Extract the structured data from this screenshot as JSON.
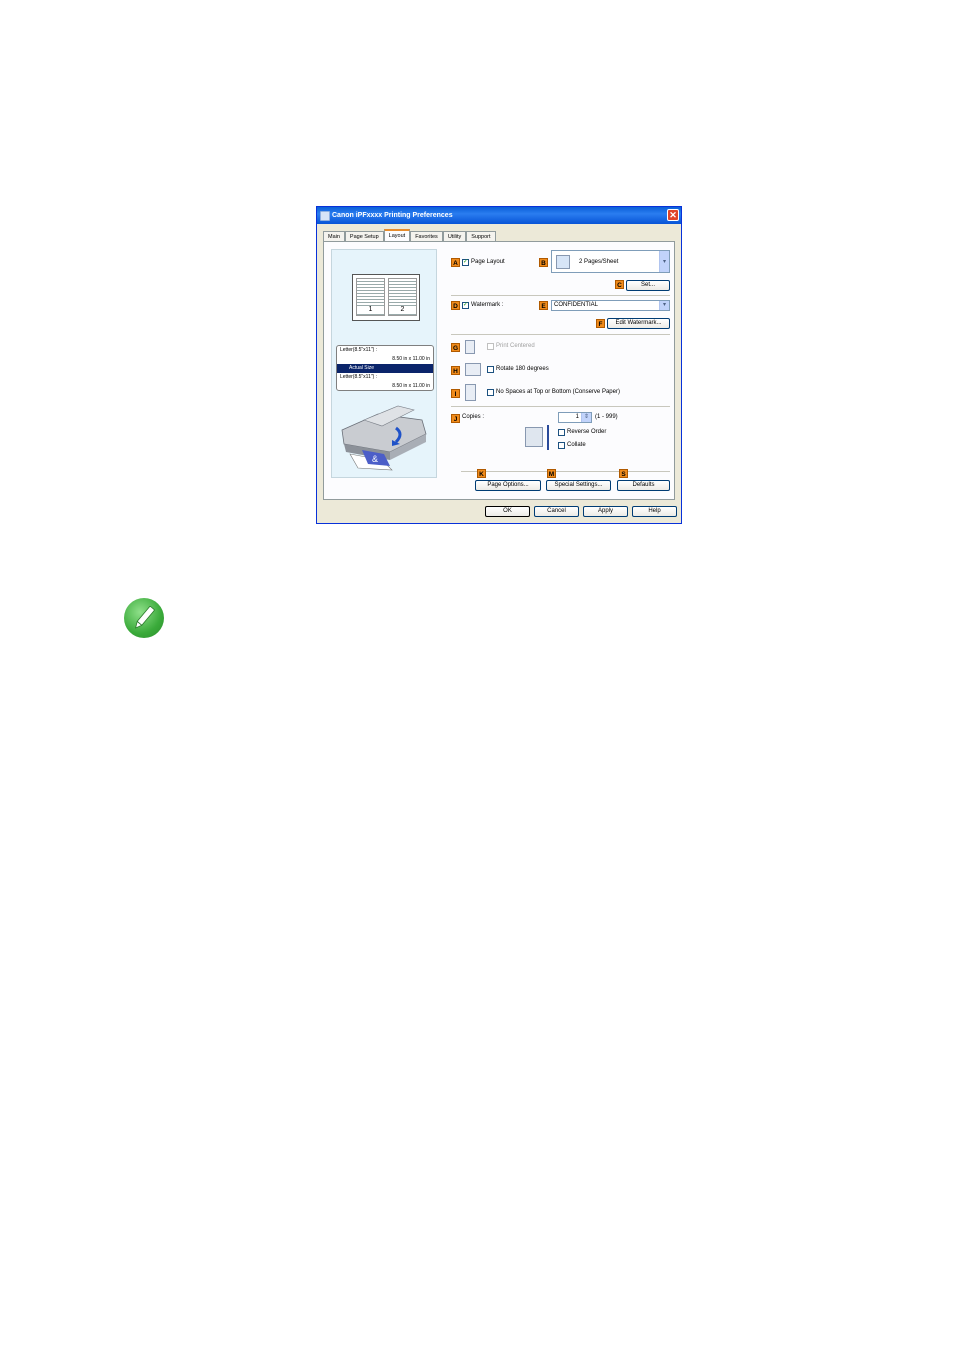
{
  "window": {
    "title": "Canon iPFxxxx Printing Preferences",
    "close_label": "✕"
  },
  "tabs": [
    {
      "label": "Main",
      "active": false
    },
    {
      "label": "Page Setup",
      "active": false
    },
    {
      "label": "Layout",
      "active": true
    },
    {
      "label": "Favorites",
      "active": false
    },
    {
      "label": "Utility",
      "active": false
    },
    {
      "label": "Support",
      "active": false
    }
  ],
  "preview": {
    "page_numbers": [
      "1",
      "2"
    ],
    "size_lines": [
      "Letter(8.5\"x11\") :",
      "8.50 in x 11.00 in",
      "Actual Size",
      "Letter(8.5\"x11\") :",
      "8.50 in x 11.00 in"
    ]
  },
  "labels": {
    "A": "A",
    "B": "B",
    "C": "C",
    "D": "D",
    "E": "E",
    "F": "F",
    "G": "G",
    "H": "H",
    "I": "I",
    "J": "J",
    "K": "K",
    "M": "M",
    "S": "S"
  },
  "layout": {
    "page_layout_label": "Page Layout",
    "page_layout_checked": true,
    "pages_per_sheet": "2 Pages/Sheet",
    "set_button": "Set...",
    "watermark_label": "Watermark :",
    "watermark_checked": true,
    "watermark_value": "CONFIDENTIAL",
    "edit_watermark_button": "Edit Watermark...",
    "print_centered_label": "Print Centered",
    "rotate_label": "Rotate 180 degrees",
    "no_spaces_label": "No Spaces at Top or Bottom (Conserve Paper)",
    "copies_label": "Copies :",
    "copies_value": "1",
    "copies_range": "(1 - 999)",
    "reverse_order_label": "Reverse Order",
    "collate_label": "Collate"
  },
  "buttons": {
    "page_options": "Page Options...",
    "special_settings": "Special Settings...",
    "defaults": "Defaults",
    "ok": "OK",
    "cancel": "Cancel",
    "apply": "Apply",
    "help": "Help"
  },
  "icons": {
    "checkmark": "✓",
    "dropdown": "▾",
    "spin": "⇕"
  },
  "colors": {
    "title_bar": "#0a5fd8",
    "label_badge": "#f08b1b",
    "note_icon": "#3aaa3a"
  }
}
